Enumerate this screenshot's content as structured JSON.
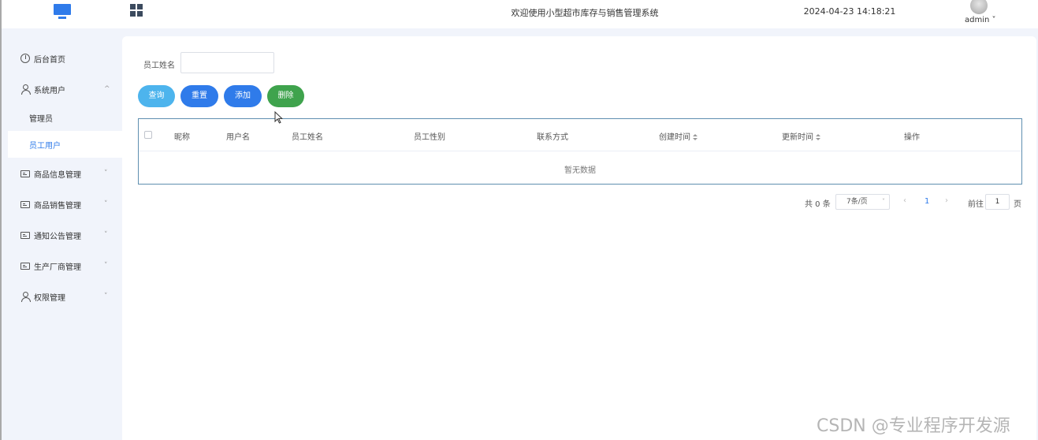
{
  "header": {
    "title": "欢迎使用小型超市库存与销售管理系统",
    "datetime": "2024-04-23 14:18:21",
    "user": "admin",
    "user_chevron": "˅"
  },
  "sidebar": {
    "items": [
      {
        "label": "后台首页",
        "icon": "clock-icon"
      },
      {
        "label": "系统用户",
        "icon": "user-icon",
        "chevron": "^"
      },
      {
        "label": "管理员"
      },
      {
        "label": "员工用户",
        "active": true
      },
      {
        "label": "商品信息管理",
        "icon": "card-icon",
        "chevron": "˅"
      },
      {
        "label": "商品销售管理",
        "icon": "card-icon",
        "chevron": "˅"
      },
      {
        "label": "通知公告管理",
        "icon": "card-icon",
        "chevron": "˅"
      },
      {
        "label": "生产厂商管理",
        "icon": "card-icon",
        "chevron": "˅"
      },
      {
        "label": "权限管理",
        "icon": "user-icon",
        "chevron": "˅"
      }
    ]
  },
  "search": {
    "label": "员工姓名",
    "value": "",
    "placeholder": ""
  },
  "buttons": {
    "query": "查询",
    "reset": "重置",
    "add": "添加",
    "delete": "删除"
  },
  "table": {
    "columns": [
      "昵称",
      "用户名",
      "员工姓名",
      "员工性别",
      "联系方式",
      "创建时间",
      "更新时间",
      "操作"
    ],
    "empty_text": "暂无数据"
  },
  "pagination": {
    "total": "共 0 条",
    "page_size": "7条/页",
    "prev": "‹",
    "current_page": "1",
    "next": "›",
    "goto_label": "前往",
    "goto_value": "1",
    "goto_unit": "页"
  },
  "watermark": "CSDN @专业程序开发源",
  "colors": {
    "primary": "#2f7bea",
    "query_button": "#4db4ed",
    "delete_button": "#3fa34d"
  }
}
